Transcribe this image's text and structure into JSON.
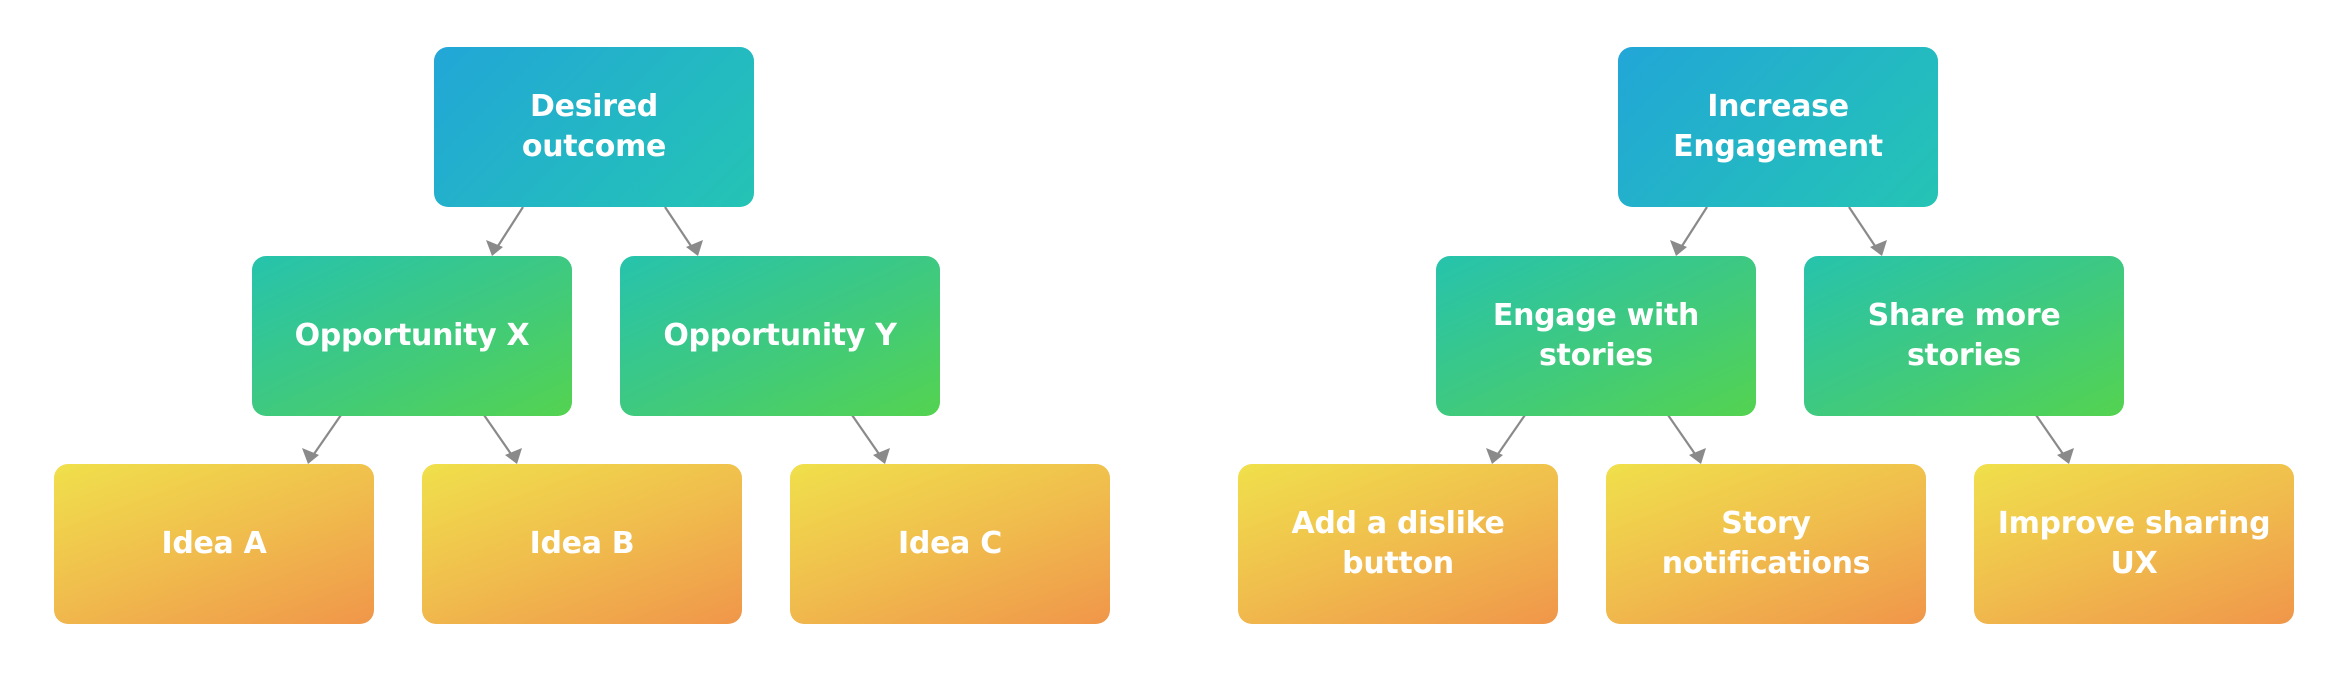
{
  "diagrams": [
    {
      "name": "generic-opportunity-tree",
      "root": "Desired outcome",
      "opportunities": [
        "Opportunity X",
        "Opportunity Y"
      ],
      "ideas": [
        "Idea A",
        "Idea B",
        "Idea C"
      ],
      "edges": [
        [
          "Desired outcome",
          "Opportunity X"
        ],
        [
          "Desired outcome",
          "Opportunity Y"
        ],
        [
          "Opportunity X",
          "Idea A"
        ],
        [
          "Opportunity X",
          "Idea B"
        ],
        [
          "Opportunity Y",
          "Idea C"
        ]
      ]
    },
    {
      "name": "engagement-opportunity-tree",
      "root": "Increase Engagement",
      "opportunities": [
        "Engage with stories",
        "Share more stories"
      ],
      "ideas": [
        "Add a dislike button",
        "Story notifications",
        "Improve sharing UX"
      ],
      "edges": [
        [
          "Increase Engagement",
          "Engage with stories"
        ],
        [
          "Increase Engagement",
          "Share more stories"
        ],
        [
          "Engage with stories",
          "Add a dislike button"
        ],
        [
          "Engage with stories",
          "Story notifications"
        ],
        [
          "Share more stories",
          "Improve sharing UX"
        ]
      ]
    }
  ],
  "colors": {
    "outcome_gradient": [
      "#22A6D7",
      "#24C4B4"
    ],
    "opportunity_gradient": [
      "#26C3AD",
      "#54D350"
    ],
    "idea_gradient": [
      "#F0E04B",
      "#F0964A"
    ],
    "arrow": "#8A8A8A",
    "text": "#FFFFFF"
  }
}
